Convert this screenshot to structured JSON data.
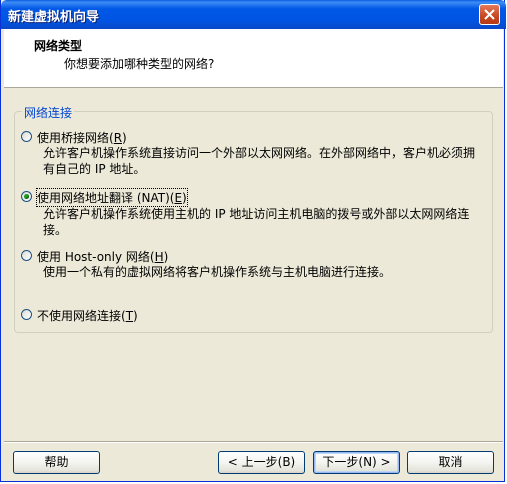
{
  "window": {
    "title": "新建虚拟机向导"
  },
  "header": {
    "title": "网络类型",
    "subtitle": "你想要添加哪种类型的网络?"
  },
  "group": {
    "legend": "网络连接"
  },
  "options": [
    {
      "label_main": "使用桥接网络(",
      "label_key": "R",
      "label_end": ")",
      "selected": false,
      "description_line1": "允许客户机操作系统直接访问一个外部以太网网络。在外部网络中，客户机必须拥",
      "description_line2": "有自己的 IP 地址。"
    },
    {
      "label_main": "使用网络地址翻译 (NAT)(",
      "label_key": "E",
      "label_end": ")",
      "selected": true,
      "description_line1": "允许客户机操作系统使用主机的 IP 地址访问主机电脑的拨号或外部以太网网络连",
      "description_line2": "接。"
    },
    {
      "label_main": "使用 Host-only 网络(",
      "label_key": "H",
      "label_end": ")",
      "selected": false,
      "description_line1": "使用一个私有的虚拟网络将客户机操作系统与主机电脑进行连接。"
    },
    {
      "label_main": "不使用网络连接(",
      "label_key": "T",
      "label_end": ")",
      "selected": false
    }
  ],
  "buttons": {
    "help": "帮助",
    "back": "< 上一步(B)",
    "next": "下一步(N) >",
    "cancel": "取消"
  },
  "icons": {
    "close": "close-icon"
  },
  "colors": {
    "titlebar": "#0054e3",
    "legend_text": "#0046d5",
    "dialog_bg": "#ece9d8",
    "radio_selected": "#21a121"
  }
}
